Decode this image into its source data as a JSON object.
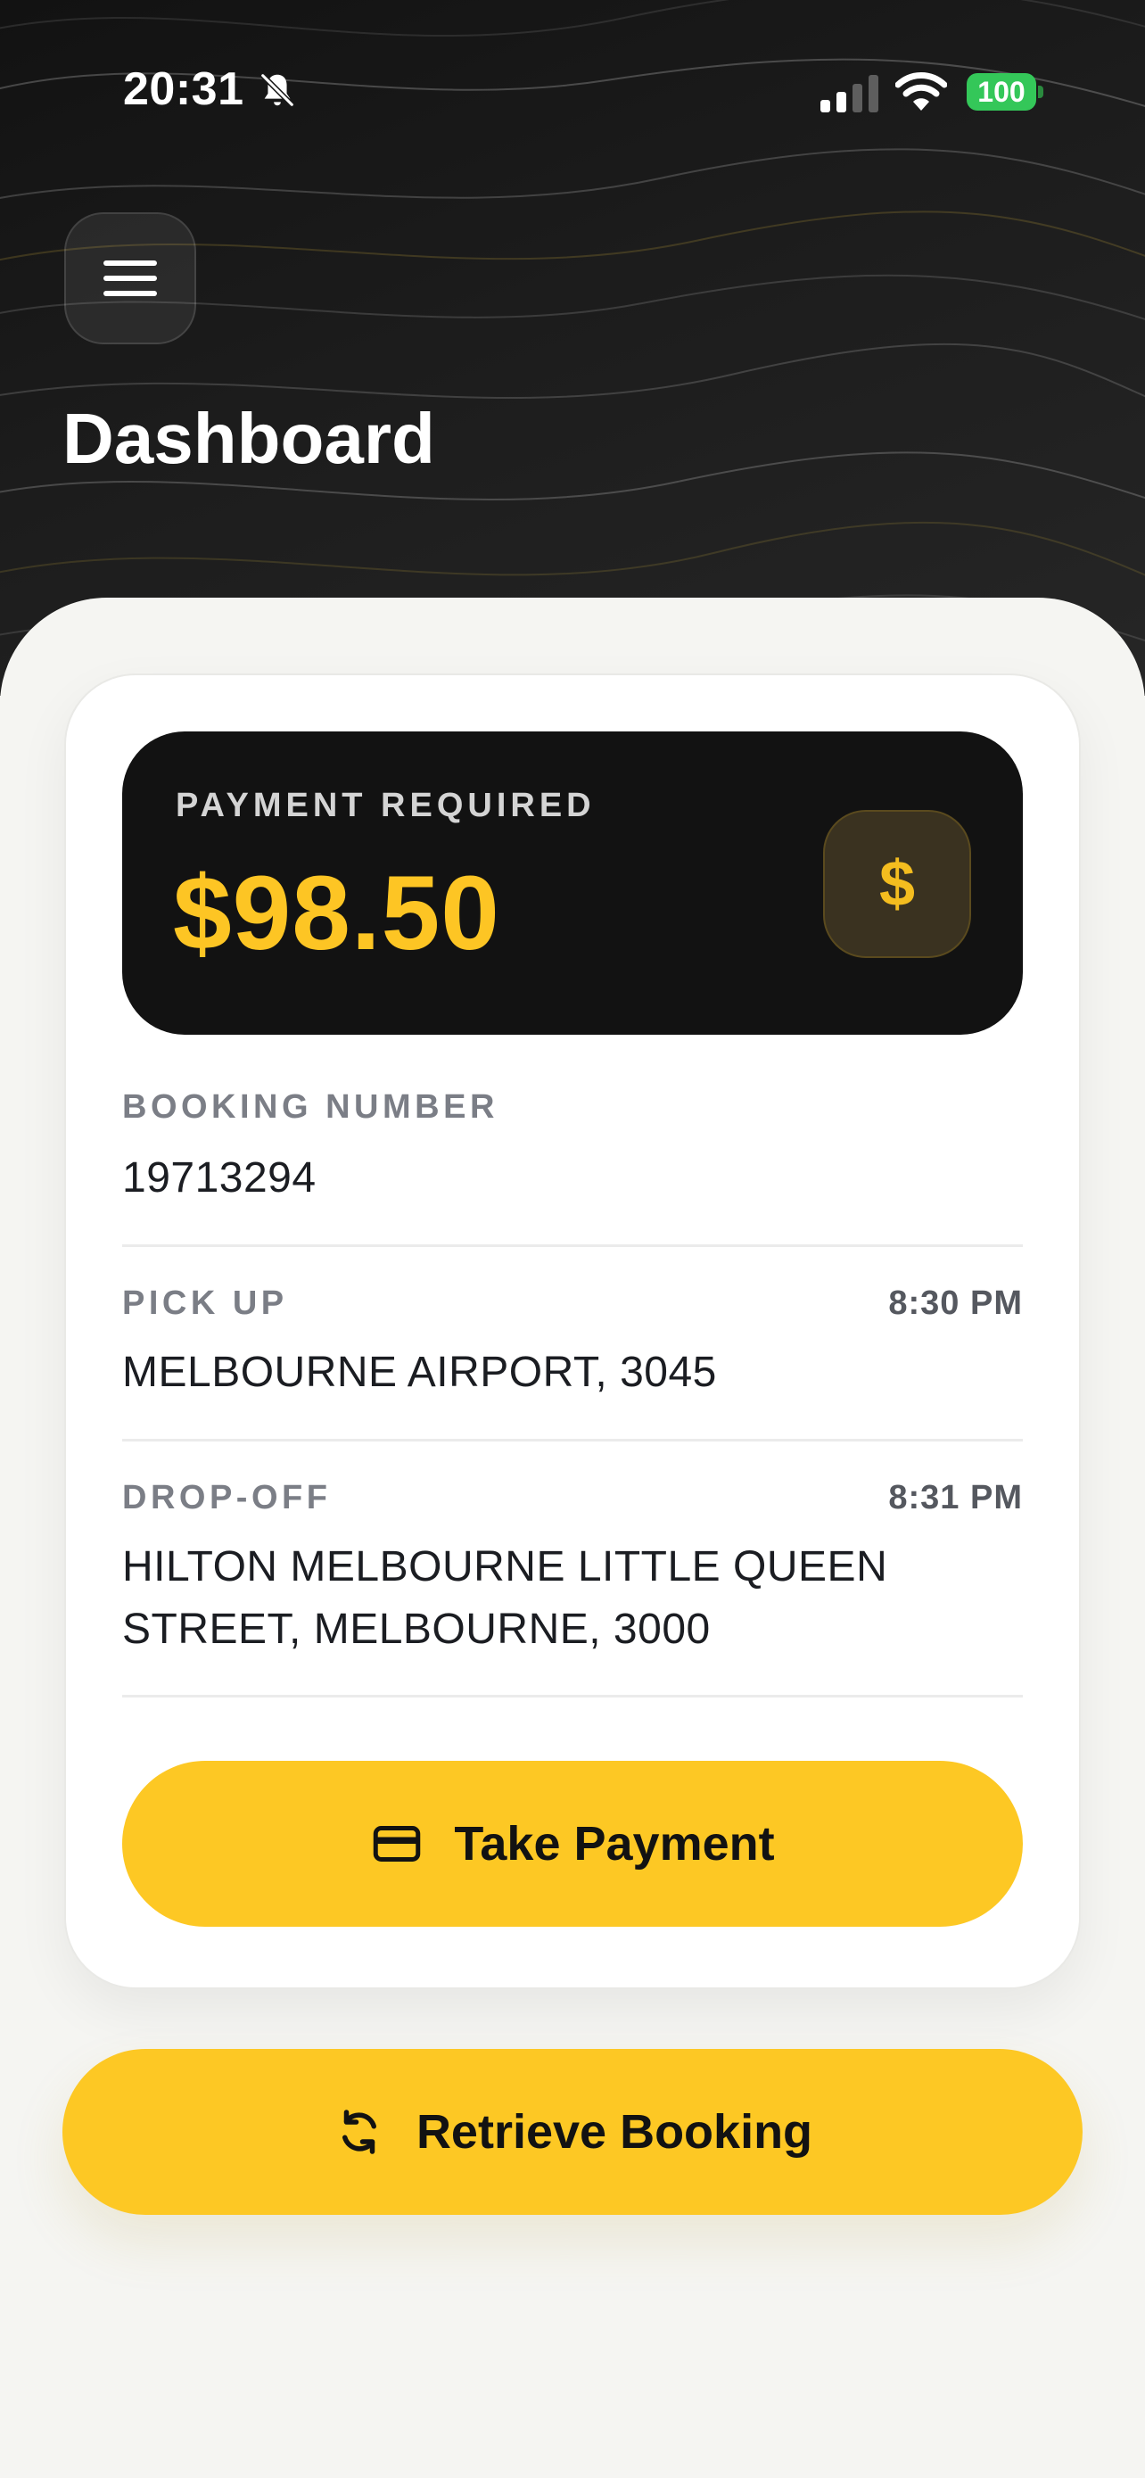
{
  "status_bar": {
    "time": "20:31",
    "battery": "100"
  },
  "header": {
    "title": "Dashboard"
  },
  "payment": {
    "label": "PAYMENT REQUIRED",
    "amount": "$98.50",
    "icon": "dollar-icon",
    "icon_glyph": "$"
  },
  "booking": {
    "label": "BOOKING NUMBER",
    "value": "19713294"
  },
  "pickup": {
    "label": "PICK UP",
    "time": "8:30 PM",
    "location": "MELBOURNE AIRPORT, 3045"
  },
  "dropoff": {
    "label": "DROP-OFF",
    "time": "8:31 PM",
    "location_line1": "HILTON MELBOURNE LITTLE QUEEN",
    "location_line2": "STREET, MELBOURNE, 3000"
  },
  "actions": {
    "take_payment": "Take Payment",
    "retrieve_booking": "Retrieve Booking"
  },
  "colors": {
    "accent": "#fdc824",
    "amount": "#fdc524",
    "dark": "#121212",
    "battery": "#34c759"
  }
}
